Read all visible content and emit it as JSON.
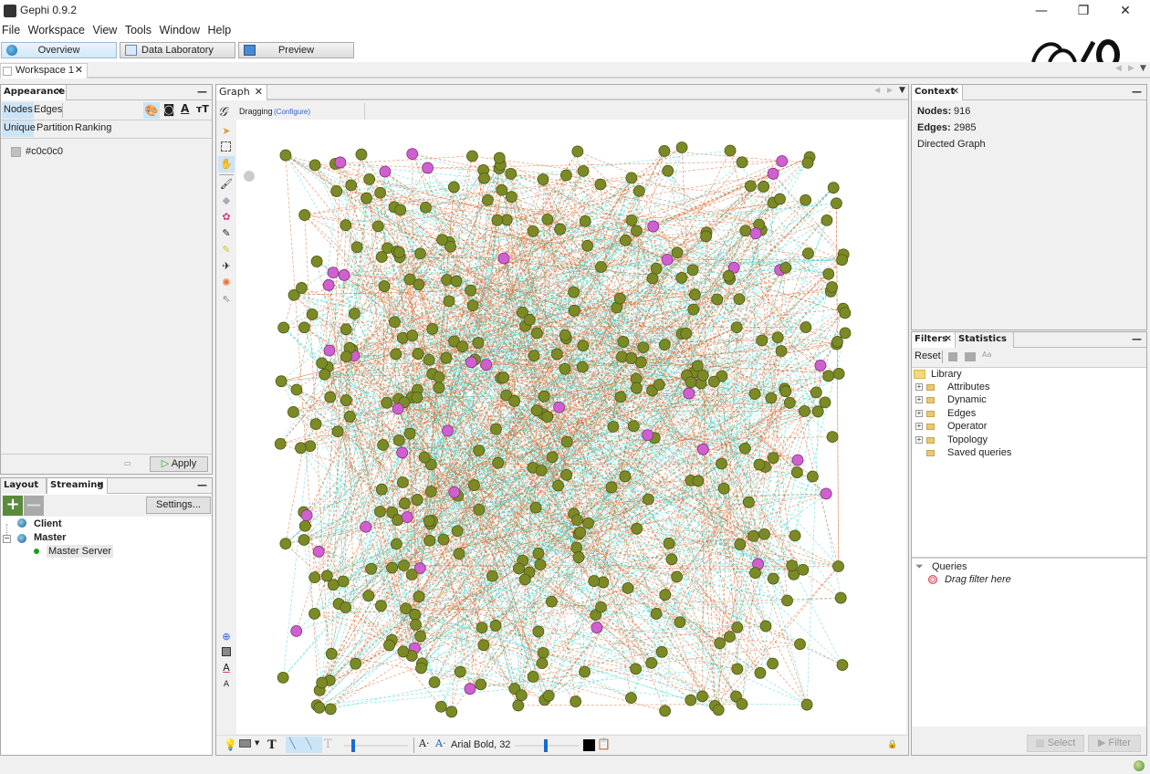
{
  "window": {
    "title": "Gephi 0.9.2",
    "minimize": "—",
    "maximize": "❐",
    "close": "✕"
  },
  "menu": [
    "File",
    "Workspace",
    "View",
    "Tools",
    "Window",
    "Help"
  ],
  "perspectives": [
    {
      "label": "Overview",
      "active": true
    },
    {
      "label": "Data Laboratory",
      "active": false
    },
    {
      "label": "Preview",
      "active": false
    }
  ],
  "workspace_tab": {
    "label": "Workspace 1",
    "close": "✕"
  },
  "appearance": {
    "tab": "Appearance",
    "close": "✕",
    "element_tabs": [
      "Nodes",
      "Edges"
    ],
    "modes": [
      "Unique",
      "Partition",
      "Ranking"
    ],
    "color_value": "#c0c0c0",
    "apply_label": "Apply"
  },
  "layout_panel": {
    "tabs": [
      "Layout",
      "Streaming"
    ],
    "settings_label": "Settings...",
    "tree": [
      {
        "label": "Client",
        "bold": true
      },
      {
        "label": "Master",
        "bold": true
      },
      {
        "label": "Master Server",
        "bold": false,
        "status_color": "#1a9e1a"
      }
    ]
  },
  "graph": {
    "tab": "Graph",
    "close": "✕",
    "mode": "Dragging",
    "configure_link": "(Configure)",
    "font_label": "Arial Bold, 32",
    "colors": {
      "node_main": "#7c8a25",
      "node_main_stroke": "#4e5716",
      "node_accent": "#d060d0",
      "node_accent_bright": "#e050d0",
      "edge_out": "#d8662a",
      "edge_in": "#40d8d0"
    }
  },
  "context": {
    "tab": "Context",
    "nodes_label": "Nodes:",
    "nodes_value": "916",
    "edges_label": "Edges:",
    "edges_value": "2985",
    "graph_type": "Directed Graph"
  },
  "filters": {
    "tabs": [
      "Filters",
      "Statistics"
    ],
    "reset_label": "Reset",
    "library_label": "Library",
    "library_items": [
      "Attributes",
      "Dynamic",
      "Edges",
      "Operator",
      "Topology",
      "Saved queries"
    ],
    "queries_label": "Queries",
    "drag_hint": "Drag filter here",
    "select_label": "Select",
    "filter_label": "Filter"
  }
}
